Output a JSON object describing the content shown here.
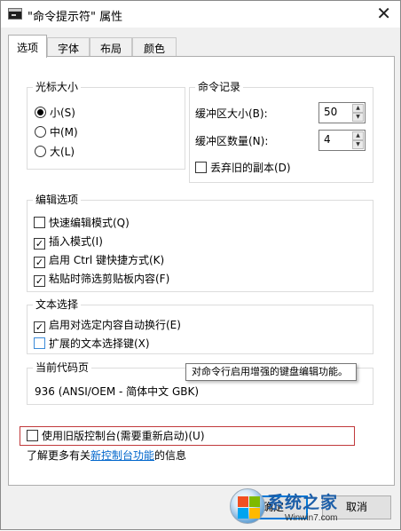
{
  "window": {
    "title": "\"命令提示符\" 属性",
    "close_glyph": "✕"
  },
  "tabs": [
    {
      "label": "选项",
      "active": true
    },
    {
      "label": "字体",
      "active": false
    },
    {
      "label": "布局",
      "active": false
    },
    {
      "label": "颜色",
      "active": false
    }
  ],
  "cursor_size": {
    "title": "光标大小",
    "options": [
      {
        "label": "小(S)",
        "checked": true
      },
      {
        "label": "中(M)",
        "checked": false
      },
      {
        "label": "大(L)",
        "checked": false
      }
    ]
  },
  "command_history": {
    "title": "命令记录",
    "buffer_size_label": "缓冲区大小(B):",
    "buffer_size_value": "50",
    "buffer_count_label": "缓冲区数量(N):",
    "buffer_count_value": "4",
    "discard_label": "丢弃旧的副本(D)",
    "discard_checked": false
  },
  "edit_options": {
    "title": "编辑选项",
    "items": [
      {
        "label": "快速编辑模式(Q)",
        "checked": false
      },
      {
        "label": "插入模式(I)",
        "checked": true
      },
      {
        "label": "启用 Ctrl 键快捷方式(K)",
        "checked": true
      },
      {
        "label": "粘贴时筛选剪贴板内容(F)",
        "checked": true
      }
    ]
  },
  "text_selection": {
    "title": "文本选择",
    "items": [
      {
        "label": "启用对选定内容自动换行(E)",
        "checked": true
      },
      {
        "label": "扩展的文本选择键(X)",
        "checked": false
      }
    ]
  },
  "code_page": {
    "title": "当前代码页",
    "value": "936   (ANSI/OEM - 简体中文 GBK)"
  },
  "tooltip": "对命令行启用增强的键盘编辑功能。",
  "legacy_console": {
    "label": "使用旧版控制台(需要重新启动)(U)",
    "checked": false
  },
  "learn_more": {
    "prefix": "了解更多有关",
    "link": "新控制台功能",
    "suffix": "的信息"
  },
  "buttons": {
    "ok": "确定",
    "cancel": "取消"
  },
  "watermark": {
    "brand": "系统之家",
    "url": "Winwin7.com"
  },
  "glyphs": {
    "check": "✓",
    "spin_up": "▲",
    "spin_down": "▼"
  },
  "colors": {
    "link": "#0066cc",
    "highlight_border": "#c0393b",
    "focus_blue": "#0078d7"
  }
}
